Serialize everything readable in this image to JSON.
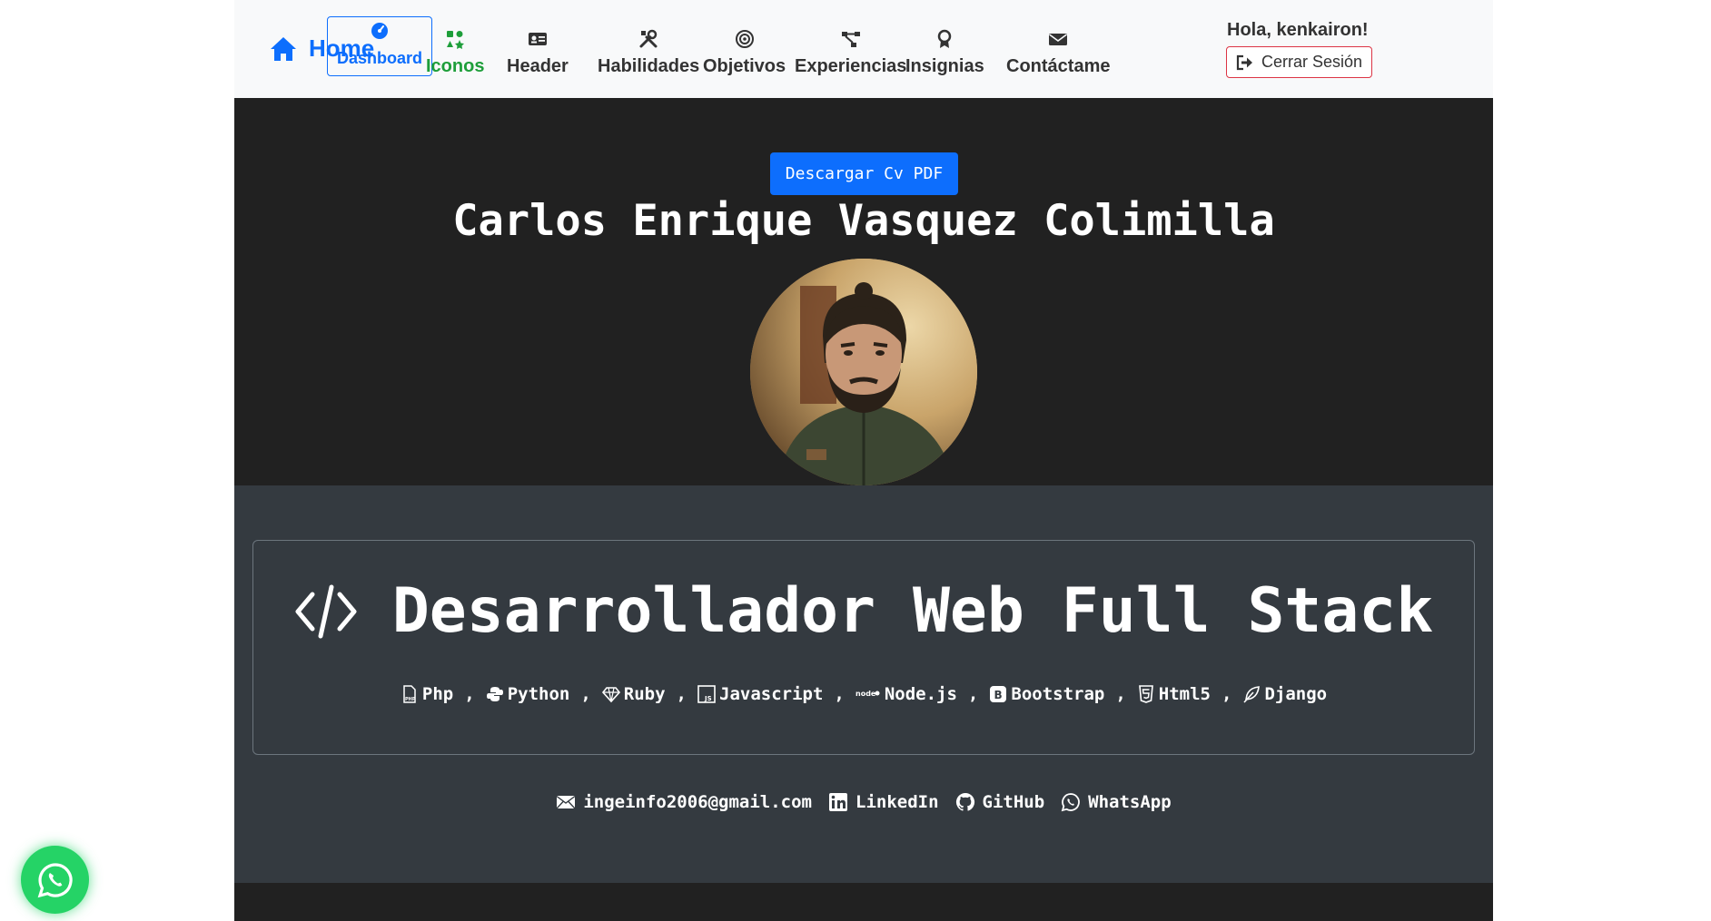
{
  "nav": {
    "brand": "Home",
    "items": [
      {
        "label": "Dashboard",
        "icon": "gauge-icon"
      },
      {
        "label": "Iconos",
        "icon": "icons-grid-icon"
      },
      {
        "label": "Header",
        "icon": "id-card-icon"
      },
      {
        "label": "Habilidades",
        "icon": "tools-icon"
      },
      {
        "label": "Objetivos",
        "icon": "target-icon"
      },
      {
        "label": "Experiencias",
        "icon": "diagram-icon"
      },
      {
        "label": "Insignias",
        "icon": "award-icon"
      },
      {
        "label": "Contáctame",
        "icon": "envelope-icon"
      }
    ],
    "greeting": "Hola, kenkairon!",
    "logout": "Cerrar Sesión"
  },
  "hero": {
    "download_cv": "Descargar Cv PDF",
    "name": "Carlos Enrique Vasquez Colimilla"
  },
  "profile": {
    "title": "Desarrollador Web Full Stack",
    "skills": [
      {
        "name": "Php",
        "icon": "php-file-icon"
      },
      {
        "name": "Python",
        "icon": "python-icon"
      },
      {
        "name": "Ruby",
        "icon": "gem-icon"
      },
      {
        "name": "Javascript",
        "icon": "js-icon"
      },
      {
        "name": "Node.js",
        "icon": "nodejs-icon"
      },
      {
        "name": "Bootstrap",
        "icon": "bootstrap-icon"
      },
      {
        "name": "Html5",
        "icon": "html5-icon"
      },
      {
        "name": "Django",
        "icon": "feather-icon"
      }
    ],
    "separator": ",",
    "contacts": {
      "email": "ingeinfo2006@gmail.com",
      "linkedin": "LinkedIn",
      "github": "GitHub",
      "whatsapp": "WhatsApp"
    }
  },
  "colors": {
    "primary": "#0d6efd",
    "iconos_green": "#1e9e3a",
    "logout_border": "#dc3545",
    "hero_bg": "#212121",
    "profile_bg": "#343a40",
    "whatsapp": "#25d366"
  }
}
